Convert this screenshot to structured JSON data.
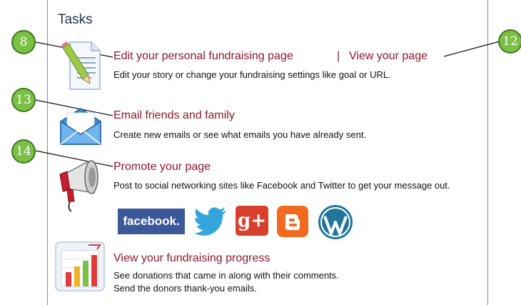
{
  "panel": {
    "title": "Tasks"
  },
  "tasks": [
    {
      "link": "Edit your personal fundraising page",
      "link2": "View your page",
      "separator": "|",
      "desc": "Edit your story or change your fundraising settings like goal or URL."
    },
    {
      "link": "Email friends and family",
      "desc": "Create new emails or see what emails you have already sent."
    },
    {
      "link": "Promote your page",
      "desc": "Post to social networking sites like Facebook and Twitter to get your message out."
    },
    {
      "link": "View your fundraising progress",
      "desc": "See donations that came in along with their comments.",
      "desc2": "Send the donors thank-you emails."
    }
  ],
  "social": {
    "facebook": "facebook.",
    "googleplus": "g+"
  },
  "callouts": [
    "8",
    "12",
    "13",
    "14"
  ],
  "colors": {
    "link": "#8b1a2b",
    "callout": "#7bbf44",
    "title": "#1f3450"
  }
}
